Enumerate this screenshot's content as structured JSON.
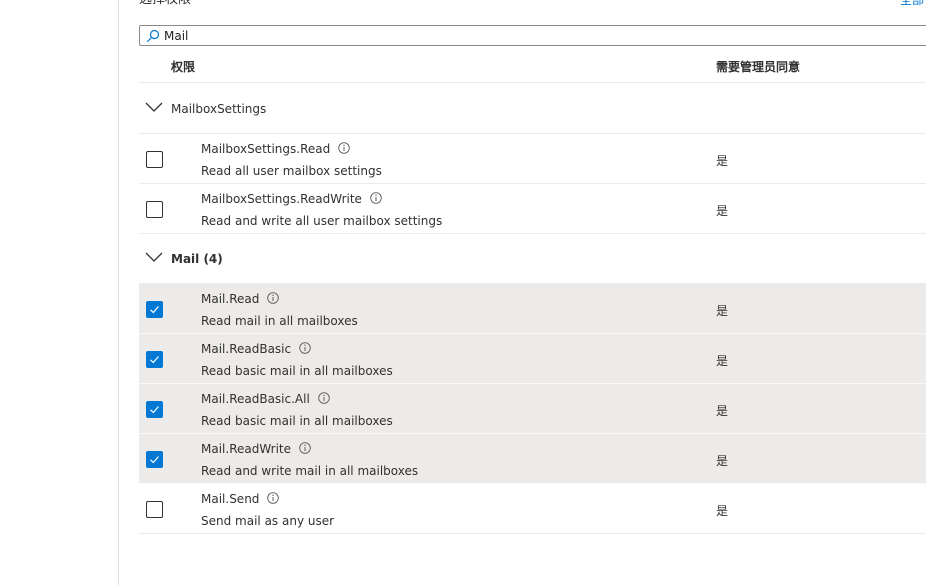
{
  "section": {
    "label": "选择权限",
    "right_link": "全部"
  },
  "search": {
    "value": "Mail",
    "icon": "search-icon"
  },
  "table": {
    "col_permission": "权限",
    "col_admin_consent": "需要管理员同意"
  },
  "groups": [
    {
      "name": "MailboxSettings",
      "rows": [
        {
          "name": "MailboxSettings.Read",
          "desc": "Read all user mailbox settings",
          "admin": "是",
          "checked": false
        },
        {
          "name": "MailboxSettings.ReadWrite",
          "desc": "Read and write all user mailbox settings",
          "admin": "是",
          "checked": false
        }
      ]
    },
    {
      "name": "Mail (4)",
      "rows": [
        {
          "name": "Mail.Read",
          "desc": "Read mail in all mailboxes",
          "admin": "是",
          "checked": true
        },
        {
          "name": "Mail.ReadBasic",
          "desc": "Read basic mail in all mailboxes",
          "admin": "是",
          "checked": true
        },
        {
          "name": "Mail.ReadBasic.All",
          "desc": "Read basic mail in all mailboxes",
          "admin": "是",
          "checked": true
        },
        {
          "name": "Mail.ReadWrite",
          "desc": "Read and write mail in all mailboxes",
          "admin": "是",
          "checked": true
        },
        {
          "name": "Mail.Send",
          "desc": "Send mail as any user",
          "admin": "是",
          "checked": false
        }
      ]
    }
  ],
  "colors": {
    "accent": "#0078d4",
    "selected_row": "#edebe9",
    "text": "#323130"
  }
}
